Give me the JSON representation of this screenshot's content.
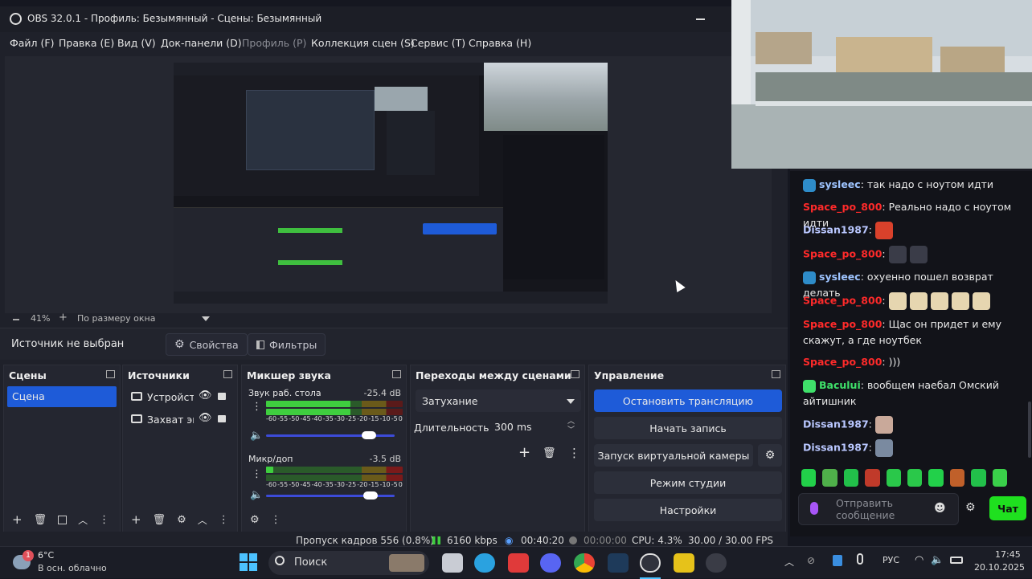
{
  "window": {
    "title": "OBS 32.0.1 - Профиль: Безымянный - Сцены: Безымянный"
  },
  "menu": [
    "Файл (F)",
    "Правка (E)",
    "Вид (V)",
    "Док-панели (D)",
    "Профиль (P)",
    "Коллекция сцен (S)",
    "Сервис (T)",
    "Справка (H)"
  ],
  "zoom": {
    "percent": "41%",
    "mode": "По размеру окна"
  },
  "source_toolbar": {
    "label": "Источник не выбран",
    "properties": "Свойства",
    "filters": "Фильтры"
  },
  "scenes": {
    "title": "Сцены",
    "items": [
      "Сцена"
    ]
  },
  "sources": {
    "title": "Источники",
    "items": [
      "Устройств",
      "Захват эк"
    ]
  },
  "mixer": {
    "title": "Микшер звука",
    "tracks": [
      {
        "name": "Звук раб. стола",
        "db": "-25.4 dB",
        "level": 0.62,
        "volume": 0.84
      },
      {
        "name": "Микр/доп",
        "db": "-3.5 dB",
        "level": 0.05,
        "volume": 0.85
      }
    ],
    "scale": [
      "-60",
      "-55",
      "-50",
      "-45",
      "-40",
      "-35",
      "-30",
      "-25",
      "-20",
      "-15",
      "-10",
      "-5",
      "0"
    ]
  },
  "transitions": {
    "title": "Переходы между сценами",
    "selected": "Затухание",
    "duration_label": "Длительность",
    "duration_value": "300 ms"
  },
  "controls": {
    "title": "Управление",
    "buttons": [
      "Остановить трансляцию",
      "Начать запись",
      "Запуск виртуальной камеры",
      "Режим студии",
      "Настройки"
    ]
  },
  "status": {
    "dropped": "Пропуск кадров 556 (0.8%)",
    "bitrate": "6160 kbps",
    "stream_time": "00:40:20",
    "rec_time": "00:00:00",
    "cpu": "CPU: 4.3%",
    "fps": "30.00 / 30.00 FPS"
  },
  "chat": {
    "messages": [
      {
        "user": "sysleec",
        "text": "так надо с ноутом идти",
        "color": "#9ec4ff",
        "badge": true
      },
      {
        "user": "Space_po_800",
        "text": "Реально надо с ноутом идти",
        "color": "#ff2a2a",
        "badge": false
      },
      {
        "user": "Dissan1987",
        "text": "",
        "color": "#b9c7ff",
        "badge": false
      },
      {
        "user": "Space_po_800",
        "text": "",
        "color": "#ff2a2a",
        "badge": false
      },
      {
        "user": "sysleec",
        "text": "охуенно пошел возврат делать",
        "color": "#9ec4ff",
        "badge": true
      },
      {
        "user": "Space_po_800",
        "text": "",
        "color": "#ff2a2a",
        "badge": false
      },
      {
        "user": "Space_po_800",
        "text": "Щас он придет и ему скажут, а где ноутбек",
        "color": "#ff2a2a",
        "badge": false
      },
      {
        "user": "Space_po_800",
        "text": ")))",
        "color": "#ff2a2a",
        "badge": false
      },
      {
        "user": "Bacului",
        "text": "вообщем наебал Омский айтишник",
        "color": "#3fe06a",
        "badge": true
      },
      {
        "user": "Dissan1987",
        "text": "",
        "color": "#b9c7ff",
        "badge": false
      },
      {
        "user": "Dissan1987",
        "text": "",
        "color": "#b9c7ff",
        "badge": false
      }
    ],
    "input_placeholder": "Отправить сообщение",
    "chat_button": "Чат"
  },
  "taskbar": {
    "weather_temp": "6°C",
    "weather_desc": "В осн. облачно",
    "weather_badge": "1",
    "search": "Поиск",
    "lang": "РУС",
    "time": "17:45",
    "date": "20.10.2025"
  },
  "colors": {
    "accent": "#1e5bd8",
    "chat_button": "#1fe01f",
    "obs_bg": "#1f212a"
  }
}
